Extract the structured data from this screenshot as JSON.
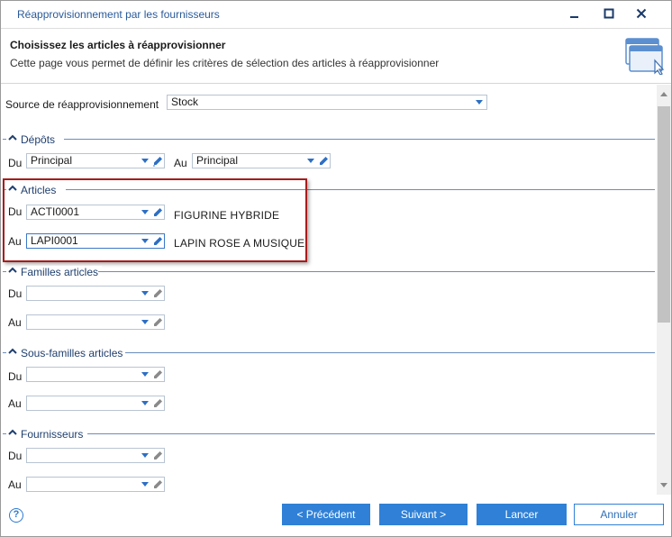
{
  "window": {
    "title": "Réapprovisionnement par les fournisseurs"
  },
  "header": {
    "title": "Choisissez les articles à réapprovisionner",
    "subtitle": "Cette page vous permet de définir les critères de sélection des articles à réapprovisionner"
  },
  "source": {
    "label": "Source de réapprovisionnement",
    "value": "Stock"
  },
  "depots": {
    "title": "Dépôts",
    "from_label": "Du",
    "from_value": "Principal",
    "to_label": "Au",
    "to_value": "Principal"
  },
  "articles": {
    "title": "Articles",
    "from_label": "Du",
    "from_value": "ACTI0001",
    "from_desc": "FIGURINE HYBRIDE",
    "to_label": "Au",
    "to_value": "LAPI0001",
    "to_desc": "LAPIN ROSE A MUSIQUE"
  },
  "familles": {
    "title": "Familles articles",
    "from_label": "Du",
    "from_value": "",
    "to_label": "Au",
    "to_value": ""
  },
  "sous_familles": {
    "title": "Sous-familles articles",
    "from_label": "Du",
    "from_value": "",
    "to_label": "Au",
    "to_value": ""
  },
  "fournisseurs": {
    "title": "Fournisseurs",
    "from_label": "Du",
    "from_value": "",
    "to_label": "Au",
    "to_value": ""
  },
  "footer": {
    "help": "?",
    "prev_label": "< Précédent",
    "next_label": "Suivant >",
    "run_label": "Lancer",
    "cancel_label": "Annuler"
  },
  "colors": {
    "accent": "#2f80d6",
    "section_title": "#1f3f6e",
    "highlight_border": "#a81c1c"
  },
  "icons": {
    "minimize": "minimize-icon",
    "maximize": "maximize-icon",
    "close": "close-icon",
    "wizard": "window-cursor-icon",
    "combo": "chevron-down-icon",
    "edit": "pencil-icon",
    "collapse": "caret-up-icon",
    "help": "help-icon"
  }
}
